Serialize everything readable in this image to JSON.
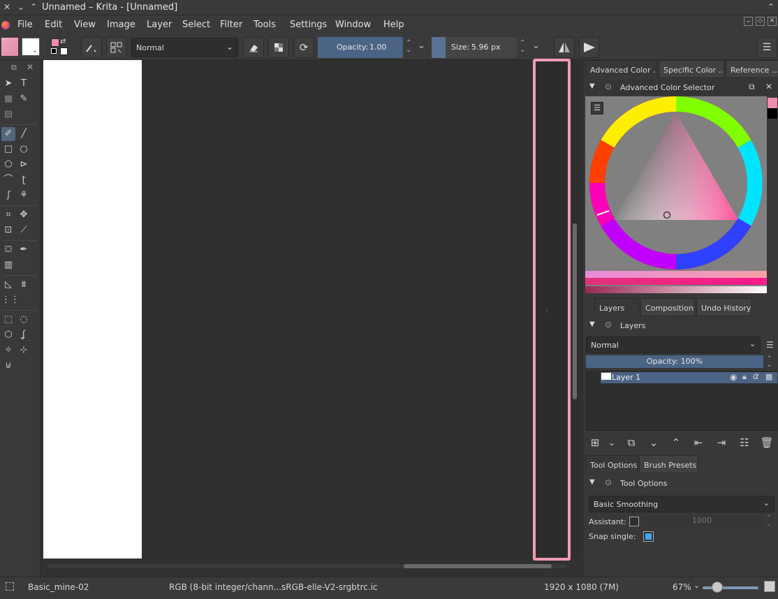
{
  "window": {
    "title": "Unnamed – Krita - [Unnamed]"
  },
  "menu": {
    "items": [
      "File",
      "Edit",
      "View",
      "Image",
      "Layer",
      "Select",
      "Filter",
      "Tools",
      "Settings",
      "Window",
      "Help"
    ]
  },
  "toolbar": {
    "blend_mode": "Normal",
    "opacity_label": "Opacity:",
    "opacity_value": "1.00",
    "size_label": "Size:",
    "size_value": "5.96 px"
  },
  "colors": {
    "foreground": "#f08cb0",
    "background": "#ffffff",
    "accent": "#4b6384",
    "frame_highlight": "#f49ab3"
  },
  "dock": {
    "color_tabs": [
      "Advanced Color ...",
      "Specific Color ...",
      "Reference ..."
    ],
    "color_panel_title": "Advanced Color Selector",
    "layer_tabs": [
      "Layers",
      "Compositions",
      "Undo History"
    ],
    "layers_panel_title": "Layers",
    "layers_blend_mode": "Normal",
    "layers_opacity": "Opacity:  100%",
    "layers": [
      {
        "name": "Layer 1",
        "selected": true
      }
    ],
    "tool_tabs": [
      "Tool Options",
      "Brush Presets"
    ],
    "tool_panel_title": "Tool Options",
    "smoothing_mode": "Basic Smoothing",
    "assistant_label": "Assistant:",
    "assistant_value": "1000",
    "snap_label": "Snap single:"
  },
  "status": {
    "brush_preset": "Basic_mine-02",
    "color_space": "RGB (8-bit integer/chann...sRGB-elle-V2-srgbtrc.ic",
    "image_size": "1920 x 1080 (7M)",
    "zoom": "67%"
  }
}
